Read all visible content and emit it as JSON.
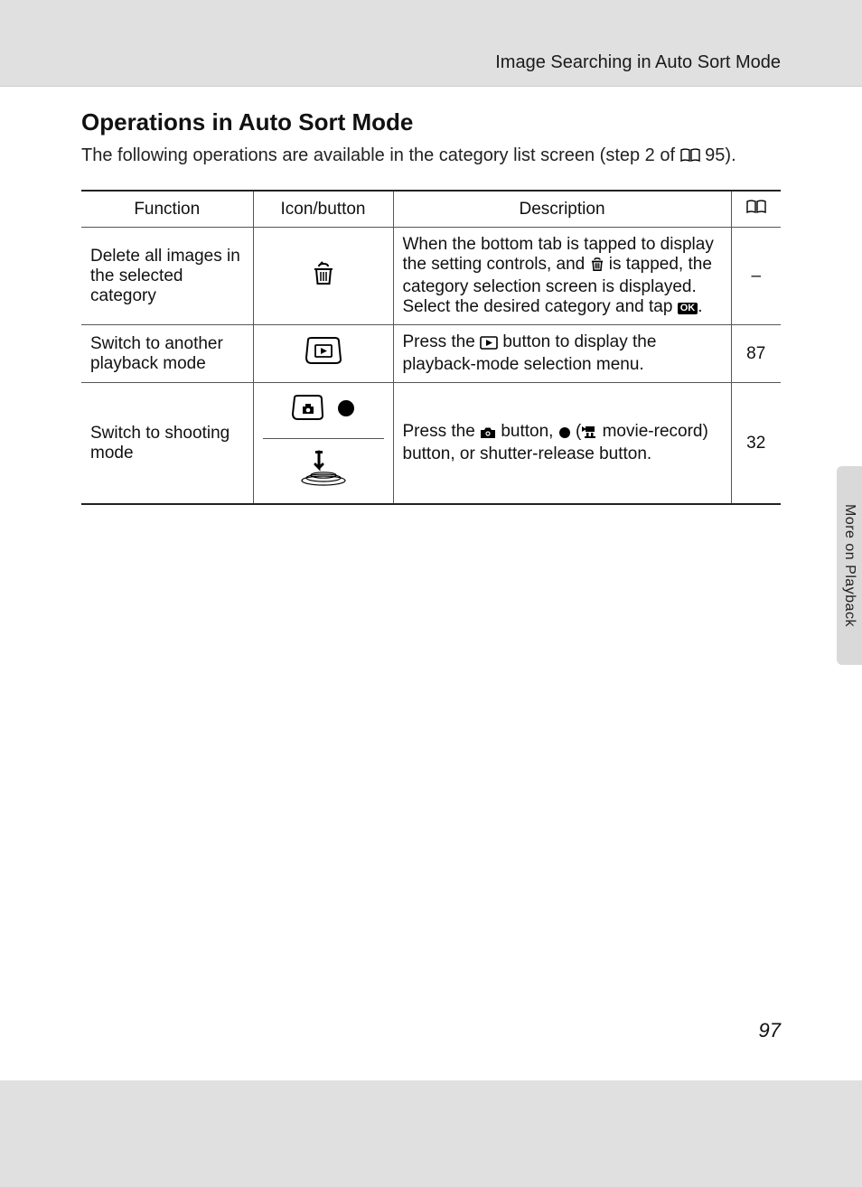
{
  "header": {
    "breadcrumb": "Image Searching in Auto Sort Mode"
  },
  "section": {
    "title": "Operations in Auto Sort Mode",
    "intro_prefix": "The following operations are available in the category list screen (step 2 of ",
    "intro_page_ref": "95",
    "intro_suffix": ")."
  },
  "table": {
    "headers": {
      "function": "Function",
      "icon": "Icon/button",
      "description": "Description",
      "page": ""
    },
    "rows": [
      {
        "function": "Delete all images in the selected category",
        "desc_1": "When the bottom tab is tapped to display the setting controls, and ",
        "desc_2": " is tapped, the category selection screen is displayed. Select the desired category and tap ",
        "desc_ok": "OK",
        "desc_3": ".",
        "page": "–"
      },
      {
        "function": "Switch to another playback mode",
        "desc_1": "Press the ",
        "desc_2": " button to display the playback-mode selection menu.",
        "page": "87"
      },
      {
        "function": "Switch to shooting mode",
        "desc_1": "Press the ",
        "desc_2": " button, ",
        "desc_3": " (",
        "desc_4": " movie-record) button, or shutter-release button.",
        "page": "32"
      }
    ]
  },
  "side_tab": "More on Playback",
  "page_number": "97"
}
